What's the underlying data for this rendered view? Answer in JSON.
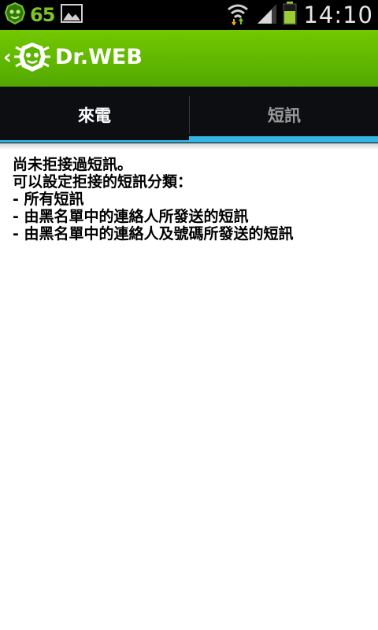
{
  "status_bar": {
    "battery_level": "65",
    "time": "14:10",
    "icons": [
      "drweb-status-icon",
      "image-icon",
      "wifi-icon",
      "signal-icon",
      "battery-icon"
    ]
  },
  "app_bar": {
    "logo_text": "Dr.WEB",
    "back_icon": "chevron-left-icon"
  },
  "tabs": [
    {
      "label": "來電",
      "selected": false
    },
    {
      "label": "短訊",
      "selected": true
    }
  ],
  "content": {
    "line1": "尚未拒接過短訊。",
    "line2": "可以設定拒接的短訊分類：",
    "item1": "-  所有短訊",
    "item2": "-  由黑名單中的連絡人所發送的短訊",
    "item3": "-  由黑名單中的連絡人及號碼所發送的短訊"
  },
  "colors": {
    "status_bg": "#000000",
    "app_bar_green": "#5cb400",
    "tab_bg": "#0c0e12",
    "tab_indicator": "#33b5e5"
  }
}
